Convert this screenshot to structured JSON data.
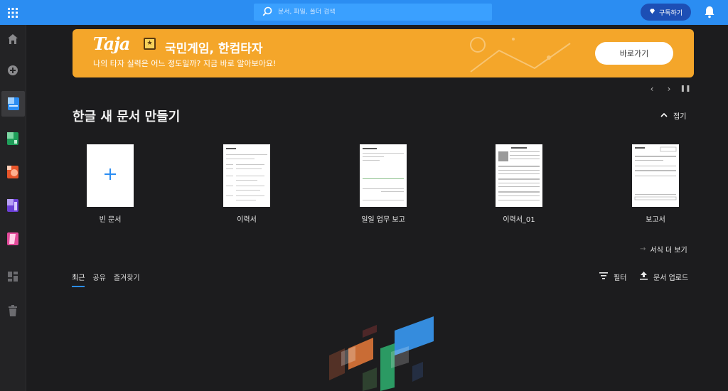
{
  "topbar": {
    "search_placeholder": "문서, 파일, 폴더 검색",
    "subscribe_label": "구독하기",
    "accent": "#2b8df2"
  },
  "sidebar": {
    "items": [
      {
        "icon": "home-icon"
      },
      {
        "icon": "add-circle-icon"
      },
      {
        "icon": "hwp-app-icon",
        "active": true
      },
      {
        "icon": "hcell-app-icon"
      },
      {
        "icon": "hshow-app-icon"
      },
      {
        "icon": "hword-app-icon"
      },
      {
        "icon": "hpdf-app-icon"
      },
      {
        "icon": "dashboard-icon"
      },
      {
        "icon": "trash-icon"
      }
    ]
  },
  "banner": {
    "logo": "Taja",
    "title": "국민게임, 한컴타자",
    "subtitle": "나의 타자 실력은 어느 정도일까? 지금 바로 알아보아요!",
    "button_label": "바로가기",
    "color": "#f4a62a"
  },
  "new_doc": {
    "title": "한글 새 문서 만들기",
    "collapse_label": "접기",
    "templates": [
      {
        "label": "빈 문서"
      },
      {
        "label": "이력서"
      },
      {
        "label": "일일 업무 보고"
      },
      {
        "label": "이력서_01"
      },
      {
        "label": "보고서"
      }
    ],
    "more_label": "서식 더 보기"
  },
  "docs": {
    "tabs": [
      "최근",
      "공유",
      "즐겨찾기"
    ],
    "active_tab": 0,
    "filter_label": "필터",
    "upload_label": "문서 업로드"
  }
}
